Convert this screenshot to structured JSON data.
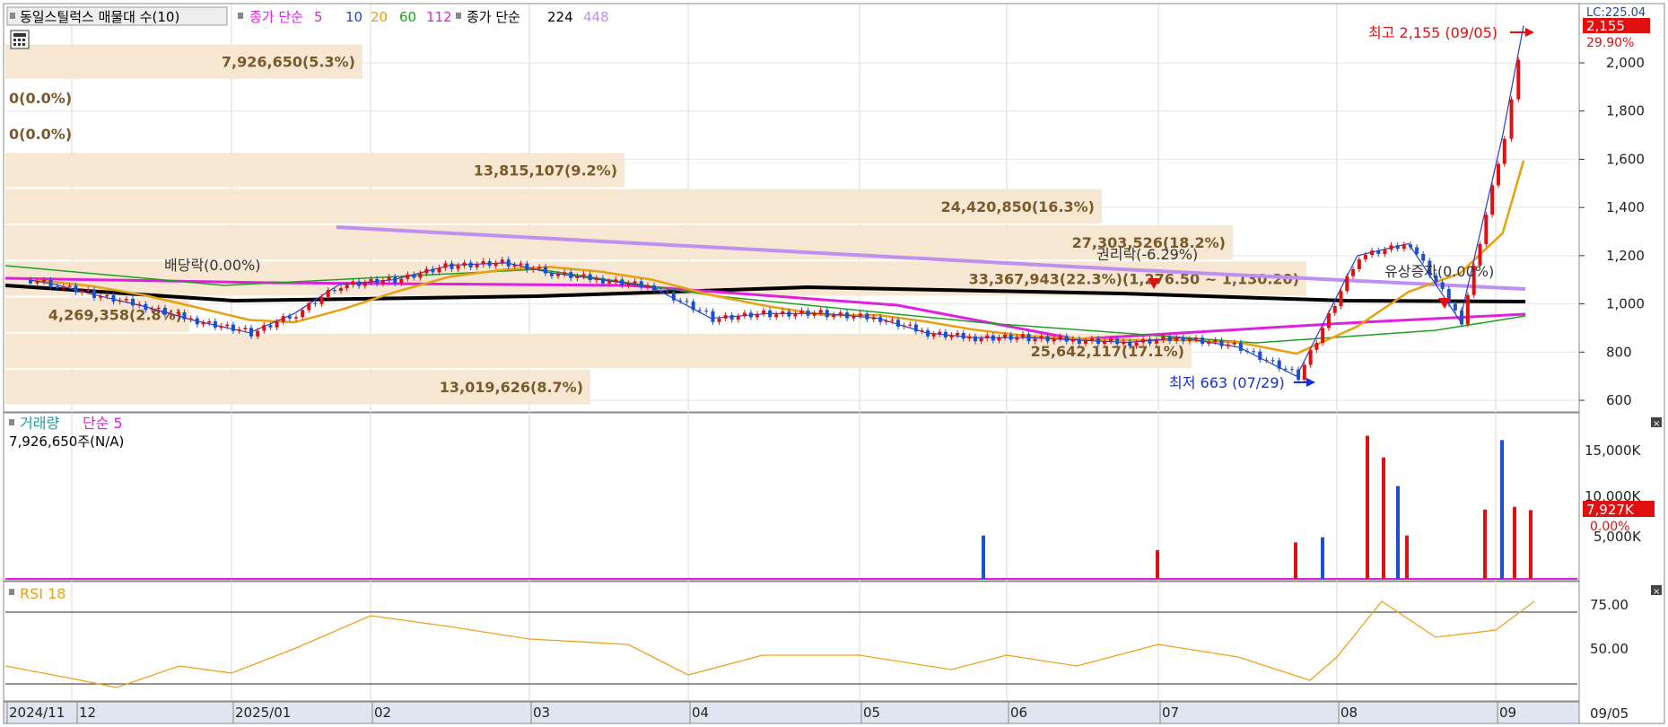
{
  "legend": {
    "stock_name": "동일스틸럭스 매물대 수(10)",
    "ma_label": "종가 단순",
    "ma_periods": [
      {
        "label": "5",
        "color": "#e020e0"
      },
      {
        "label": "10",
        "color": "#2040d0"
      },
      {
        "label": "20",
        "color": "#e8a010"
      },
      {
        "label": "60",
        "color": "#20a020"
      },
      {
        "label": "112",
        "color": "#e020e0"
      }
    ],
    "ma2_label": "종가 단순",
    "ma2_periods": [
      {
        "label": "224",
        "color": "#000000"
      },
      {
        "label": "448",
        "color": "#c090f0"
      }
    ]
  },
  "price_axis": {
    "ticks": [
      "2,000",
      "1,800",
      "1,600",
      "1,400",
      "1,200",
      "1,000",
      "800",
      "600"
    ],
    "current_price": "2,155",
    "current_change": "29.90%",
    "top_label": "LC:225.04"
  },
  "annotations": {
    "high": "최고 2,155 (09/05)",
    "low": "최저 663 (07/29)",
    "dividend": "배당락(0.00%)",
    "rights": "권리락(-6.29%)",
    "paid_in": "유상증자(0.00%)"
  },
  "volume_panel": {
    "title": "거래량",
    "ma_label": "단순 5",
    "current_volume": "7,926,650주(N/A)",
    "ticks": [
      "15,000K",
      "10,000K",
      "5,000K"
    ],
    "current_label": "7,927K",
    "current_change": "0.00%"
  },
  "rsi_panel": {
    "title": "RSI 18",
    "ticks": [
      "75.00",
      "50.00"
    ]
  },
  "x_axis": {
    "labels": [
      "2024/11",
      "12",
      "2025/01",
      "02",
      "03",
      "04",
      "05",
      "06",
      "07",
      "08",
      "09"
    ],
    "date_box": "09/05"
  },
  "chart_data": {
    "type": "candlestick",
    "price_range": [
      600,
      2155
    ],
    "volume_profile": [
      {
        "label": "7,926,650(5.3%)",
        "price_from": 1930,
        "price_to": 2080
      },
      {
        "label": "0(0.0%)",
        "price_from": 1780,
        "price_to": 1930
      },
      {
        "label": "0(0.0%)",
        "price_from": 1630,
        "price_to": 1780
      },
      {
        "label": "13,815,107(9.2%)",
        "price_from": 1480,
        "price_to": 1630
      },
      {
        "label": "24,420,850(16.3%)",
        "price_from": 1330,
        "price_to": 1480
      },
      {
        "label": "27,303,526(18.2%)",
        "price_from": 1180,
        "price_to": 1330
      },
      {
        "label": "33,367,943(22.3%)(1,276.50 ~ 1,130.20)",
        "price_from": 1030,
        "price_to": 1180
      },
      {
        "label": "4,269,358(2.8%)",
        "price_from": 880,
        "price_to": 1030
      },
      {
        "label": "25,642,117(17.1%)",
        "price_from": 730,
        "price_to": 880
      },
      {
        "label": "13,019,626(8.7%)",
        "price_from": 580,
        "price_to": 730
      }
    ],
    "close_series": [
      {
        "date": "2024-11-15",
        "close": 1100
      },
      {
        "date": "2024-11-25",
        "close": 1080
      },
      {
        "date": "2024-12-05",
        "close": 1040
      },
      {
        "date": "2024-12-15",
        "close": 990
      },
      {
        "date": "2024-12-25",
        "close": 930
      },
      {
        "date": "2025-01-05",
        "close": 880
      },
      {
        "date": "2025-01-15",
        "close": 960
      },
      {
        "date": "2025-01-25",
        "close": 1080
      },
      {
        "date": "2025-02-05",
        "close": 1100
      },
      {
        "date": "2025-02-15",
        "close": 1160
      },
      {
        "date": "2025-02-25",
        "close": 1170
      },
      {
        "date": "2025-03-05",
        "close": 1130
      },
      {
        "date": "2025-03-15",
        "close": 1100
      },
      {
        "date": "2025-03-25",
        "close": 1070
      },
      {
        "date": "2025-04-05",
        "close": 940
      },
      {
        "date": "2025-04-15",
        "close": 960
      },
      {
        "date": "2025-04-25",
        "close": 960
      },
      {
        "date": "2025-05-05",
        "close": 940
      },
      {
        "date": "2025-05-15",
        "close": 880
      },
      {
        "date": "2025-05-25",
        "close": 860
      },
      {
        "date": "2025-06-05",
        "close": 860
      },
      {
        "date": "2025-06-15",
        "close": 850
      },
      {
        "date": "2025-06-25",
        "close": 840
      },
      {
        "date": "2025-07-05",
        "close": 860
      },
      {
        "date": "2025-07-15",
        "close": 820
      },
      {
        "date": "2025-07-25",
        "close": 700
      },
      {
        "date": "2025-08-05",
        "close": 1200
      },
      {
        "date": "2025-08-15",
        "close": 1250
      },
      {
        "date": "2025-08-25",
        "close": 930
      },
      {
        "date": "2025-09-02",
        "close": 1700
      },
      {
        "date": "2025-09-05",
        "close": 2155
      }
    ]
  }
}
